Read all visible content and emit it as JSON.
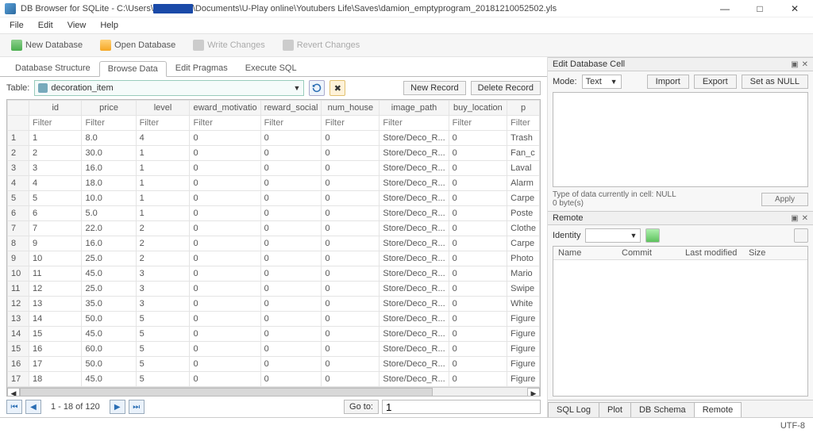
{
  "window": {
    "title_prefix": "DB Browser for SQLite - C:\\Users\\",
    "title_suffix": "\\Documents\\U-Play online\\Youtubers Life\\Saves\\damion_emptyprogram_20181210052502.yls",
    "sys_min": "—",
    "sys_max": "□",
    "sys_close": "✕"
  },
  "menu": {
    "file": "File",
    "edit": "Edit",
    "view": "View",
    "help": "Help"
  },
  "toolbar": {
    "new_db": "New Database",
    "open_db": "Open Database",
    "write": "Write Changes",
    "revert": "Revert Changes"
  },
  "main_tabs": {
    "structure": "Database Structure",
    "browse": "Browse Data",
    "pragmas": "Edit Pragmas",
    "execute": "Execute SQL"
  },
  "table_ctl": {
    "label": "Table:",
    "selected": "decoration_item",
    "new_record": "New Record",
    "delete_record": "Delete Record"
  },
  "columns": [
    "id",
    "price",
    "level",
    "eward_motivatio",
    "reward_social",
    "num_house",
    "image_path",
    "buy_location",
    "p"
  ],
  "filter_placeholder": "Filter",
  "rows": [
    {
      "n": 1,
      "c": [
        "1",
        "8.0",
        "4",
        "0",
        "0",
        "0",
        "Store/Deco_R...",
        "0",
        "Trash"
      ]
    },
    {
      "n": 2,
      "c": [
        "2",
        "30.0",
        "1",
        "0",
        "0",
        "0",
        "Store/Deco_R...",
        "0",
        "Fan_c"
      ]
    },
    {
      "n": 3,
      "c": [
        "3",
        "16.0",
        "1",
        "0",
        "0",
        "0",
        "Store/Deco_R...",
        "0",
        "Laval"
      ]
    },
    {
      "n": 4,
      "c": [
        "4",
        "18.0",
        "1",
        "0",
        "0",
        "0",
        "Store/Deco_R...",
        "0",
        "Alarm"
      ]
    },
    {
      "n": 5,
      "c": [
        "5",
        "10.0",
        "1",
        "0",
        "0",
        "0",
        "Store/Deco_R...",
        "0",
        "Carpe"
      ]
    },
    {
      "n": 6,
      "c": [
        "6",
        "5.0",
        "1",
        "0",
        "0",
        "0",
        "Store/Deco_R...",
        "0",
        "Poste"
      ]
    },
    {
      "n": 7,
      "c": [
        "7",
        "22.0",
        "2",
        "0",
        "0",
        "0",
        "Store/Deco_R...",
        "0",
        "Clothe"
      ]
    },
    {
      "n": 8,
      "c": [
        "9",
        "16.0",
        "2",
        "0",
        "0",
        "0",
        "Store/Deco_R...",
        "0",
        "Carpe"
      ]
    },
    {
      "n": 9,
      "c": [
        "10",
        "25.0",
        "2",
        "0",
        "0",
        "0",
        "Store/Deco_R...",
        "0",
        "Photo"
      ]
    },
    {
      "n": 10,
      "c": [
        "11",
        "45.0",
        "3",
        "0",
        "0",
        "0",
        "Store/Deco_R...",
        "0",
        "Mario"
      ]
    },
    {
      "n": 11,
      "c": [
        "12",
        "25.0",
        "3",
        "0",
        "0",
        "0",
        "Store/Deco_R...",
        "0",
        "Swipe"
      ]
    },
    {
      "n": 12,
      "c": [
        "13",
        "35.0",
        "3",
        "0",
        "0",
        "0",
        "Store/Deco_R...",
        "0",
        "White"
      ]
    },
    {
      "n": 13,
      "c": [
        "14",
        "50.0",
        "5",
        "0",
        "0",
        "0",
        "Store/Deco_R...",
        "0",
        "Figure"
      ]
    },
    {
      "n": 14,
      "c": [
        "15",
        "45.0",
        "5",
        "0",
        "0",
        "0",
        "Store/Deco_R...",
        "0",
        "Figure"
      ]
    },
    {
      "n": 15,
      "c": [
        "16",
        "60.0",
        "5",
        "0",
        "0",
        "0",
        "Store/Deco_R...",
        "0",
        "Figure"
      ]
    },
    {
      "n": 16,
      "c": [
        "17",
        "50.0",
        "5",
        "0",
        "0",
        "0",
        "Store/Deco_R...",
        "0",
        "Figure"
      ]
    },
    {
      "n": 17,
      "c": [
        "18",
        "45.0",
        "5",
        "0",
        "0",
        "0",
        "Store/Deco_R...",
        "0",
        "Figure"
      ]
    }
  ],
  "pager": {
    "range": "1 - 18 of 120",
    "goto_label": "Go to:",
    "goto_value": "1"
  },
  "edit_cell": {
    "title": "Edit Database Cell",
    "mode_label": "Mode:",
    "mode_value": "Text",
    "import": "Import",
    "export": "Export",
    "set_null": "Set as NULL",
    "type_info": "Type of data currently in cell: NULL",
    "bytes": "0 byte(s)",
    "apply": "Apply"
  },
  "remote": {
    "title": "Remote",
    "identity_label": "Identity",
    "cols": {
      "name": "Name",
      "commit": "Commit",
      "lm": "Last modified",
      "size": "Size"
    }
  },
  "bottom_tabs": {
    "sql_log": "SQL Log",
    "plot": "Plot",
    "schema": "DB Schema",
    "remote": "Remote"
  },
  "status": {
    "encoding": "UTF-8"
  }
}
